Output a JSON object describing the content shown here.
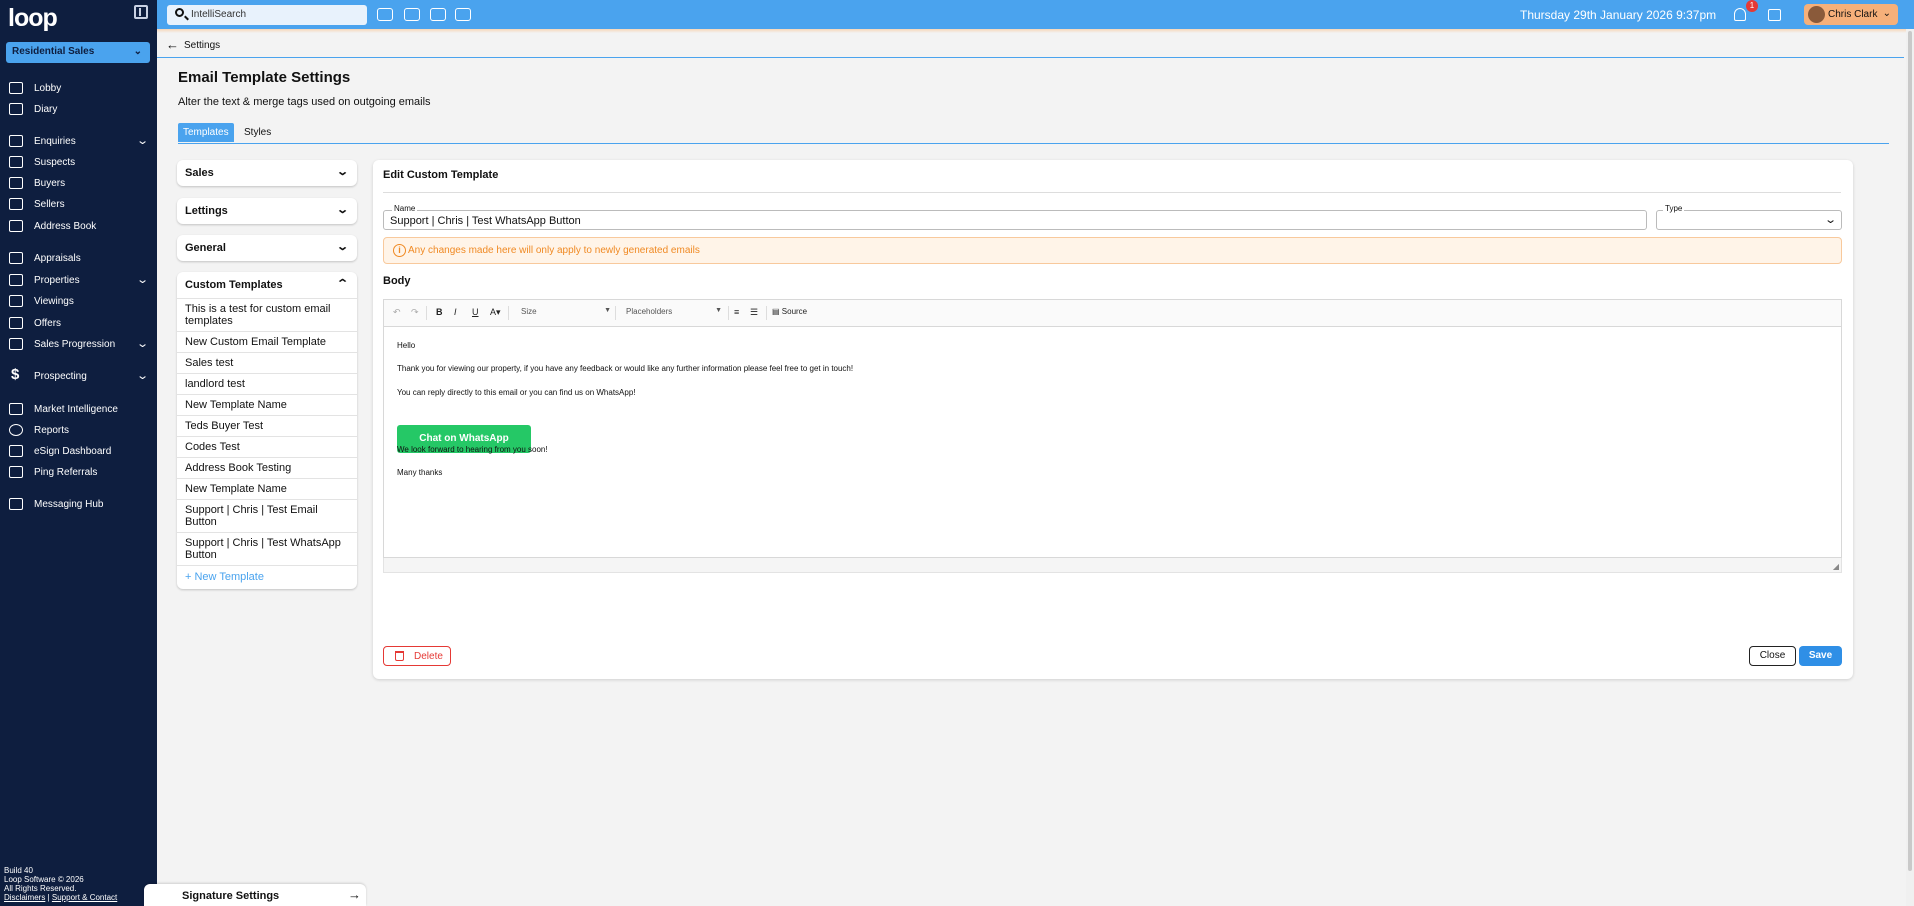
{
  "sidebar": {
    "logo": "loop",
    "branch": "Residential Sales",
    "items": [
      {
        "label": "Lobby",
        "icon": "grid-icon"
      },
      {
        "label": "Diary",
        "icon": "calendar-icon"
      },
      {
        "label": "Enquiries",
        "icon": "inbox-icon",
        "expandable": true
      },
      {
        "label": "Suspects",
        "icon": "id-card-icon"
      },
      {
        "label": "Buyers",
        "icon": "buyers-icon"
      },
      {
        "label": "Sellers",
        "icon": "sellers-icon"
      },
      {
        "label": "Address Book",
        "icon": "book-icon"
      },
      {
        "label": "Appraisals",
        "icon": "clipboard-icon"
      },
      {
        "label": "Properties",
        "icon": "building-icon",
        "expandable": true
      },
      {
        "label": "Viewings",
        "icon": "eye-icon"
      },
      {
        "label": "Offers",
        "icon": "gavel-icon"
      },
      {
        "label": "Sales Progression",
        "icon": "progression-icon",
        "expandable": true
      },
      {
        "label": "Prospecting",
        "icon": "dollar-icon",
        "expandable": true
      },
      {
        "label": "Market Intelligence",
        "icon": "chart-icon"
      },
      {
        "label": "Reports",
        "icon": "globe-icon"
      },
      {
        "label": "eSign Dashboard",
        "icon": "esign-icon"
      },
      {
        "label": "Ping Referrals",
        "icon": "tag-icon"
      },
      {
        "label": "Messaging Hub",
        "icon": "message-icon"
      }
    ],
    "footer": {
      "build": "Build 40",
      "copyright": "Loop Software © 2026",
      "rights": "All Rights Reserved.",
      "disclaimers": "Disclaimers",
      "separator": "|",
      "support": "Support & Contact"
    }
  },
  "topbar": {
    "search_placeholder": "IntelliSearch",
    "datetime": "Thursday 29th January 2026 9:37pm",
    "notification_count": "1",
    "user_name": "Chris Clark"
  },
  "breadcrumb": {
    "label": "Settings"
  },
  "page": {
    "title": "Email Template Settings",
    "subtitle": "Alter the text & merge tags used on outgoing emails",
    "tabs": [
      "Templates",
      "Styles"
    ]
  },
  "categories": {
    "sales": "Sales",
    "lettings": "Lettings",
    "general": "General",
    "custom": "Custom Templates",
    "custom_items": [
      "This is a test for custom email templates",
      "New Custom Email Template",
      "Sales test",
      "landlord test",
      "New Template Name",
      "Teds Buyer Test",
      "Codes Test",
      "Address Book Testing",
      "New Template Name",
      "Support | Chris | Test Email Button",
      "Support | Chris | Test WhatsApp Button"
    ],
    "new_template": "+ New Template",
    "signature": "Signature Settings"
  },
  "editor": {
    "title": "Edit Custom Template",
    "name_label": "Name",
    "name_value": "Support | Chris | Test WhatsApp Button",
    "type_label": "Type",
    "type_value": "",
    "warning": "Any changes made here will only apply to newly generated emails",
    "body_label": "Body",
    "toolbar": {
      "size": "Size",
      "placeholders": "Placeholders",
      "source": "Source"
    },
    "content": {
      "greeting": "Hello",
      "line1": "Thank you for viewing our property, if you have any feedback or would like any further information please feel free to get in touch!",
      "line2": "You can reply directly to this email or you can find us on WhatsApp!",
      "button": "Chat on WhatsApp",
      "line3": "We look forward to hearing from you soon!",
      "signoff": "Many thanks"
    },
    "delete_label": "Delete",
    "close_label": "Close",
    "save_label": "Save"
  },
  "colors": {
    "sidebar_bg": "#0e1e3f",
    "accent": "#4aa3ee",
    "whatsapp_green": "#25c866",
    "warning_orange": "#f08a24",
    "danger_red": "#e53935",
    "user_chip": "#f6b07a"
  }
}
